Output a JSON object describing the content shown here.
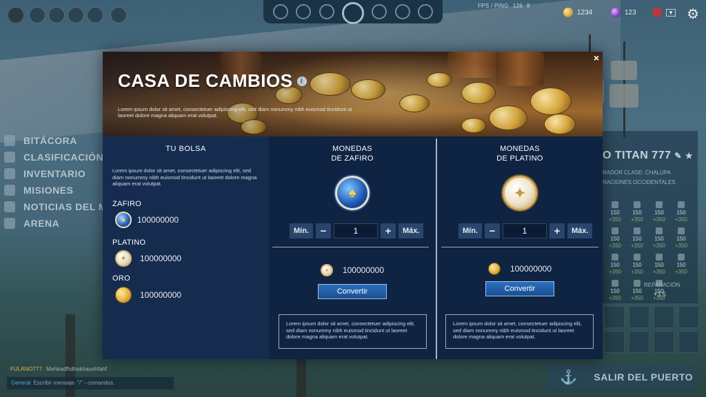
{
  "hud": {
    "fps_label": "FPS / PING",
    "fps_value": "126",
    "ping_value": "8",
    "gold_amount": "1234",
    "gems_amount": "123"
  },
  "left_menu": [
    {
      "label": "BITÁCORA",
      "icon": "book-icon"
    },
    {
      "label": "CLASIFICACIÓN",
      "icon": "trophy-icon"
    },
    {
      "label": "INVENTARIO",
      "icon": "chest-icon"
    },
    {
      "label": "MISIONES",
      "icon": "flag-icon"
    },
    {
      "label": "NOTICIAS DEL MUN",
      "icon": "globe-icon"
    },
    {
      "label": "ARENA",
      "icon": "swords-icon"
    }
  ],
  "ship_panel": {
    "name": "O TITAN 777",
    "sub1": "RADOR   CLASE: CHALUPA",
    "sub2": "NACIONES OCCIDENTALES",
    "stats": [
      {
        "v": "150",
        "b": "+350"
      },
      {
        "v": "150",
        "b": "+350"
      },
      {
        "v": "150",
        "b": "+350"
      },
      {
        "v": "150",
        "b": "+350"
      },
      {
        "v": "150",
        "b": "+350"
      },
      {
        "v": "150",
        "b": "+350"
      },
      {
        "v": "150",
        "b": "+350"
      },
      {
        "v": "150",
        "b": "+350"
      },
      {
        "v": "150",
        "b": "+350"
      },
      {
        "v": "150",
        "b": "+350"
      },
      {
        "v": "150",
        "b": "+350"
      },
      {
        "v": "150",
        "b": "+350"
      },
      {
        "v": "150",
        "b": "+350"
      },
      {
        "v": "150",
        "b": "+350"
      },
      {
        "v": "150",
        "b": "+350"
      }
    ],
    "repair_label": "REPARACIÓN",
    "repair_value": "+3.5"
  },
  "chat": {
    "sender": "FULANO777:",
    "message": "Mehkadfhdhakhauohfahf",
    "channel": "General",
    "placeholder": "Escribir mensaje. \"/\" - comandos."
  },
  "exit_button": "SALIR DEL PUERTO",
  "modal": {
    "title": "CASA DE CAMBIOS",
    "description": "Lorem ipsum dolor sit amet, consectetuer adipiscing elit, sed diam nonummy nibh euismod tincidunt ut laoreet dolore magna aliquam erat volutpat.",
    "close": "×",
    "bolsa": {
      "title": "TU BOLSA",
      "description": "Lorem ipsum dolor sit amet, consectetuer adipiscing elit, sed diam nonummy nibh euismod tincidunt ut laoreet dolore magna aliquam erat volutpat.",
      "items": [
        {
          "label": "ZAFIRO",
          "amount": "100000000"
        },
        {
          "label": "PLATINO",
          "amount": "100000000"
        },
        {
          "label": "ORO",
          "amount": "100000000"
        }
      ]
    },
    "zafiro": {
      "title_line1": "MONEDAS",
      "title_line2": "DE ZAFIRO",
      "min_label": "Mín.",
      "max_label": "Máx.",
      "quantity": "1",
      "result_amount": "100000000",
      "convert_label": "Convertir",
      "note": "Lorem ipsum dolor sit amet, consectetuer adipiscing elit, sed diam nonummy nibh euismod tincidunt ut laoreet dolore magna aliquam erat volutpat."
    },
    "platino": {
      "title_line1": "MONEDAS",
      "title_line2": "DE PLATINO",
      "min_label": "Mín.",
      "max_label": "Máx.",
      "quantity": "1",
      "result_amount": "100000000",
      "convert_label": "Convertir",
      "note": "Lorem ipsum dolor sit amet, consectetuer adipiscing elit, sed diam nonummy nibh euismod tincidunt ut laoreet dolore magna aliquam erat volutpat."
    }
  },
  "colors": {
    "modal_bg": "#13284a",
    "button_blue": "#2a6fbf",
    "gold": "#e2b23c",
    "sapphire": "#1e5fb8"
  }
}
